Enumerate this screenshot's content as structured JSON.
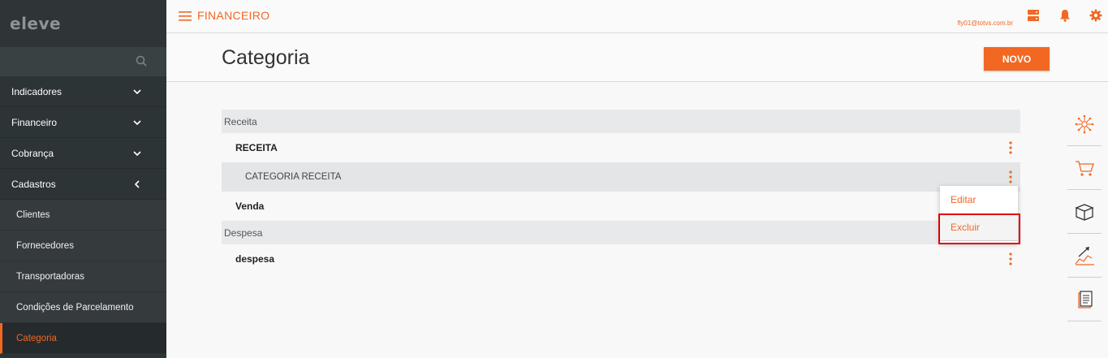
{
  "sidebar": {
    "logo": "eleve",
    "menu": [
      {
        "label": "Indicadores"
      },
      {
        "label": "Financeiro"
      },
      {
        "label": "Cobrança"
      },
      {
        "label": "Cadastros"
      }
    ],
    "subitems": [
      {
        "label": "Clientes"
      },
      {
        "label": "Fornecedores"
      },
      {
        "label": "Transportadoras"
      },
      {
        "label": "Condições de Parcelamento"
      },
      {
        "label": "Categoria"
      }
    ]
  },
  "topbar": {
    "module": "FINANCEIRO",
    "email": "fly01@totvs.com.br"
  },
  "page": {
    "title": "Categoria",
    "new_button": "NOVO"
  },
  "list": {
    "groups": [
      {
        "header": "Receita",
        "rows": [
          {
            "label": "RECEITA"
          },
          {
            "label": "CATEGORIA RECEITA"
          },
          {
            "label": "Venda"
          }
        ]
      },
      {
        "header": "Despesa",
        "rows": [
          {
            "label": "despesa"
          }
        ]
      }
    ]
  },
  "dropdown": {
    "edit": "Editar",
    "delete": "Excluir"
  },
  "colors": {
    "accent": "#f26722",
    "sidebar": "#2d3436",
    "highlight_box": "#e00000"
  },
  "icons": {
    "top": [
      "server-icon",
      "bell-icon",
      "gear-icon"
    ],
    "right_bar": [
      "network-icon",
      "cart-icon",
      "box-icon",
      "growth-chart-icon",
      "document-icon"
    ]
  }
}
